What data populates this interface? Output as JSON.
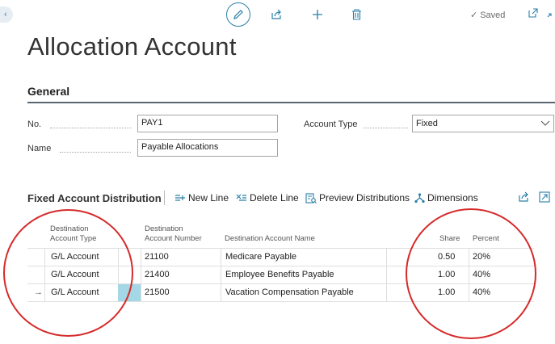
{
  "toolbar": {
    "saved_label": "Saved",
    "icons": [
      "edit-icon",
      "share-icon",
      "add-icon",
      "delete-icon",
      "checkmark-icon",
      "open-new-window-icon",
      "collapse-icon"
    ]
  },
  "page": {
    "title": "Allocation Account"
  },
  "general": {
    "heading": "General",
    "no_label": "No.",
    "no_value": "PAY1",
    "name_label": "Name",
    "name_value": "Payable Allocations",
    "account_type_label": "Account Type",
    "account_type_value": "Fixed"
  },
  "distribution": {
    "title": "Fixed Account Distribution",
    "actions": {
      "new_line": "New Line",
      "delete_line": "Delete Line",
      "preview": "Preview Distributions",
      "dimensions": "Dimensions"
    },
    "columns": {
      "dest_type_1": "Destination",
      "dest_type_2": "Account Type",
      "dest_num_1": "Destination",
      "dest_num_2": "Account Number",
      "dest_name": "Destination Account Name",
      "share": "Share",
      "percent": "Percent"
    },
    "rows": [
      {
        "type": "G/L Account",
        "number": "21100",
        "name": "Medicare Payable",
        "share": "0.50",
        "percent": "20%",
        "indicator": ""
      },
      {
        "type": "G/L Account",
        "number": "21400",
        "name": "Employee Benefits Payable",
        "share": "1.00",
        "percent": "40%",
        "indicator": ""
      },
      {
        "type": "G/L Account",
        "number": "21500",
        "name": "Vacation Compensation Payable",
        "share": "1.00",
        "percent": "40%",
        "indicator": "→"
      }
    ]
  },
  "colors": {
    "accent": "#2a7fa8",
    "annotation": "#d52a2a",
    "selected_cell": "#a4d8e6"
  }
}
